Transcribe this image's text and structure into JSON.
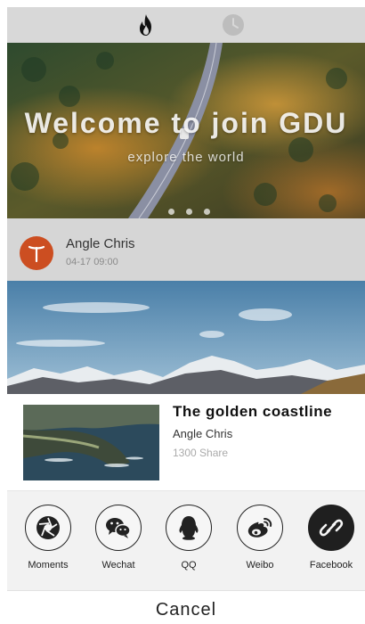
{
  "tabs": [
    {
      "icon": "fire-icon",
      "active": true
    },
    {
      "icon": "clock-icon",
      "active": false
    }
  ],
  "banner": {
    "title": "Welcome to join GDU",
    "subtitle": "explore the world",
    "page_dots": 3
  },
  "post": {
    "author": "Angle Chris",
    "time": "04-17 09:00",
    "avatar_color": "#cc4e21"
  },
  "share_card": {
    "title": "The golden coastline",
    "author": "Angle Chris",
    "shares": "1300 Share"
  },
  "share_targets": [
    {
      "label": "Moments",
      "icon": "aperture-icon"
    },
    {
      "label": "Wechat",
      "icon": "wechat-icon"
    },
    {
      "label": "QQ",
      "icon": "qq-penguin-icon"
    },
    {
      "label": "Weibo",
      "icon": "weibo-icon"
    },
    {
      "label": "Facebook",
      "icon": "link-icon"
    }
  ],
  "cancel_label": "Cancel"
}
